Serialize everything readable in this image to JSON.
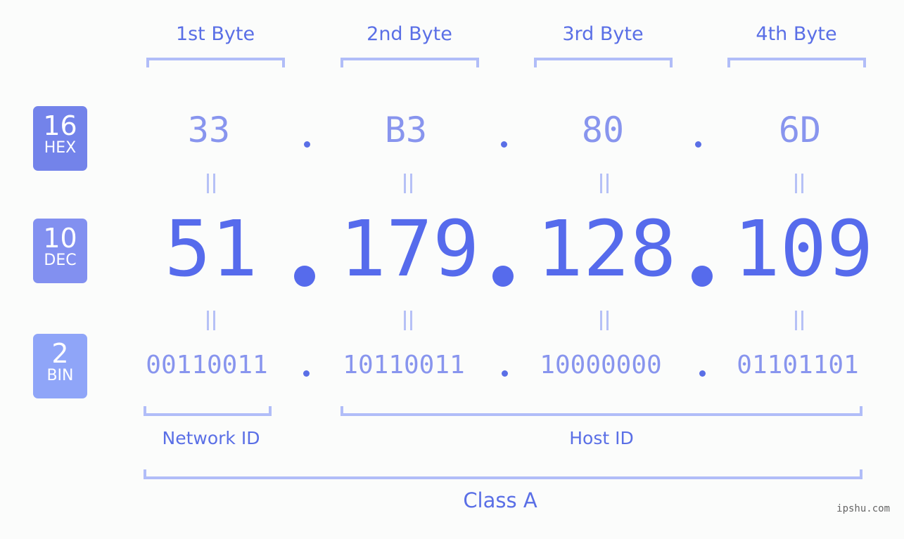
{
  "headers": [
    "1st Byte",
    "2nd Byte",
    "3rd Byte",
    "4th Byte"
  ],
  "badges": {
    "hex": {
      "num": "16",
      "label": "HEX",
      "color": "#7383ea"
    },
    "dec": {
      "num": "10",
      "label": "DEC",
      "color": "#8290f0"
    },
    "bin": {
      "num": "2",
      "label": "BIN",
      "color": "#8fa5f8"
    }
  },
  "hex": [
    "33",
    "B3",
    "80",
    "6D"
  ],
  "dec": [
    "51",
    "179",
    "128",
    "109"
  ],
  "bin": [
    "00110011",
    "10110011",
    "10000000",
    "01101101"
  ],
  "separator": ".",
  "network_id_label": "Network ID",
  "host_id_label": "Host ID",
  "class_label": "Class A",
  "watermark": "ipshu.com",
  "colors": {
    "accent": "#566bec",
    "light_accent": "#8895ee",
    "bracket": "#b1bdf8"
  }
}
